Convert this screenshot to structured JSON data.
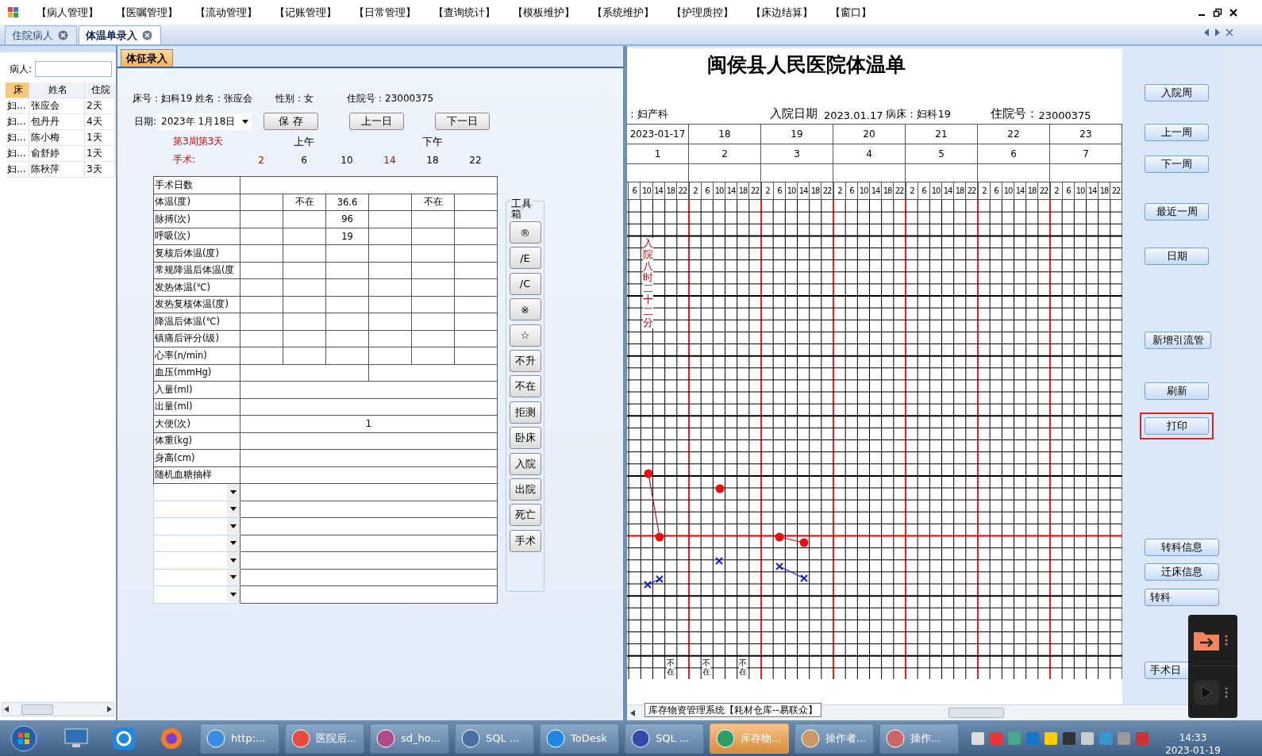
{
  "menu": {
    "items": [
      "【病人管理】",
      "【医嘱管理】",
      "【流动管理】",
      "【记账管理】",
      "【日常管理】",
      "【查询统计】",
      "【模板维护】",
      "【系统维护】",
      "【护理质控】",
      "【床边结算】",
      "【窗口】"
    ]
  },
  "tabs": [
    {
      "label": "住院病人",
      "selected": false
    },
    {
      "label": "体温单录入",
      "selected": true
    }
  ],
  "patient_panel": {
    "search_label": "病人:",
    "columns": [
      "床",
      "姓名",
      "住院"
    ],
    "rows": [
      [
        "妇...",
        "张应会",
        "2天"
      ],
      [
        "妇...",
        "包丹丹",
        "4天"
      ],
      [
        "妇...",
        "陈小梅",
        "1天"
      ],
      [
        "妇...",
        "俞舒婷",
        "1天"
      ],
      [
        "妇...",
        "陈秋萍",
        "3天"
      ]
    ]
  },
  "form": {
    "tab": "体征录入",
    "info": [
      "床号：妇科19 姓名：张应会",
      "性别：女",
      "住院号：23000375"
    ],
    "date_label": "日期:",
    "date_value": "2023年 1月18日",
    "buttons": [
      "保 存",
      "上一日",
      "下一日"
    ],
    "week_day": "第3周第3天",
    "am": "上午",
    "pm": "下午",
    "surgery_label": "手术:",
    "hours": [
      {
        "text": "2",
        "highlight": true
      },
      {
        "text": "6",
        "highlight": false
      },
      {
        "text": "10",
        "highlight": false
      },
      {
        "text": "14",
        "highlight": true
      },
      {
        "text": "18",
        "highlight": false
      },
      {
        "text": "22",
        "highlight": false
      }
    ],
    "rows": [
      {
        "kind": "merged",
        "label": "手术日数"
      },
      {
        "kind": "six",
        "label": "体温(度)",
        "cells": [
          null,
          "不在",
          "36.6",
          null,
          "不在",
          null
        ]
      },
      {
        "kind": "six",
        "label": "脉搏(次)",
        "cells": [
          null,
          null,
          "96",
          null,
          null,
          null
        ]
      },
      {
        "kind": "six",
        "label": "呼吸(次)",
        "cells": [
          null,
          null,
          "19",
          null,
          null,
          null
        ]
      },
      {
        "kind": "six",
        "label": "复核后体温(度)"
      },
      {
        "kind": "six",
        "label": "常规降温后体温(度"
      },
      {
        "kind": "six",
        "label": "发热体温(℃)"
      },
      {
        "kind": "six",
        "label": "发热复核体温(度)"
      },
      {
        "kind": "six",
        "label": "降温后体温(℃)"
      },
      {
        "kind": "six",
        "label": "镇痛后评分(级)"
      },
      {
        "kind": "six",
        "label": "心率(n/min)"
      },
      {
        "kind": "two",
        "label": "血压(mmHg)"
      },
      {
        "kind": "merged",
        "label": "入量(ml)"
      },
      {
        "kind": "merged",
        "label": "出量(ml)"
      },
      {
        "kind": "merged",
        "label": "大便(次)",
        "value": "1"
      },
      {
        "kind": "merged",
        "label": "体重(kg)"
      },
      {
        "kind": "merged",
        "label": "身高(cm)"
      },
      {
        "kind": "merged",
        "label": "随机血糖抽样"
      },
      {
        "kind": "dropdown"
      },
      {
        "kind": "dropdown"
      },
      {
        "kind": "dropdown"
      },
      {
        "kind": "dropdown"
      },
      {
        "kind": "dropdown"
      },
      {
        "kind": "dropdown"
      },
      {
        "kind": "dropdown"
      }
    ]
  },
  "toolbox": {
    "title": "工具箱",
    "buttons": [
      "®",
      "/E",
      "/C",
      "※",
      "☆",
      "不升",
      "不在",
      "拒测",
      "卧床",
      "入院",
      "出院",
      "死亡",
      "手术"
    ]
  },
  "chart": {
    "title": "闽侯县人民医院体温单",
    "dept": "：妇产科",
    "admit_label": "入院日期",
    "admit_date": "2023.01.17",
    "bed": "病床：妇科19",
    "inpatient_label": "住院号：",
    "inpatient_no": "23000375",
    "days": [
      {
        "date": "2023-01-17",
        "day": "1",
        "hours": [
          "6",
          "10",
          "14",
          "18",
          "22"
        ]
      },
      {
        "date": "18",
        "day": "2",
        "hours": [
          "2",
          "6",
          "10",
          "14",
          "18",
          "22"
        ]
      },
      {
        "date": "19",
        "day": "3",
        "hours": [
          "2",
          "6",
          "10",
          "14",
          "18",
          "22"
        ]
      },
      {
        "date": "20",
        "day": "4",
        "hours": [
          "2",
          "6",
          "10",
          "14",
          "18",
          "22"
        ]
      },
      {
        "date": "21",
        "day": "5",
        "hours": [
          "2",
          "6",
          "10",
          "14",
          "18",
          "22"
        ]
      },
      {
        "date": "22",
        "day": "6",
        "hours": [
          "2",
          "6",
          "10",
          "14",
          "18",
          "22"
        ]
      },
      {
        "date": "23",
        "day": "7",
        "hours": [
          "2",
          "6",
          "10",
          "14",
          "18",
          "22"
        ]
      }
    ],
    "admission_note": "入院八时二十二分",
    "absent_marks": [
      "不在",
      "不在",
      "不在"
    ]
  },
  "chart_buttons": [
    {
      "label": "入院周",
      "highlighted": false
    },
    {
      "label": "上一周",
      "highlighted": false
    },
    {
      "label": "下一周",
      "highlighted": false
    },
    {
      "label": "最近一周",
      "highlighted": false
    },
    {
      "label": "日期",
      "highlighted": false
    },
    {
      "label": "新增引流管",
      "highlighted": false
    },
    {
      "label": "刷新",
      "highlighted": false
    },
    {
      "label": "打印",
      "highlighted": true
    },
    {
      "label": "转科信息",
      "highlighted": false
    },
    {
      "label": "迁床信息",
      "highlighted": false
    },
    {
      "label": "转科",
      "highlighted": false
    },
    {
      "label": "手术日",
      "highlighted": false
    }
  ],
  "tooltip": "库存物资管理系统【耗材仓库--易联众】",
  "taskbar": {
    "items": [
      {
        "label": "http:...",
        "active": false
      },
      {
        "label": "医院后...",
        "active": false
      },
      {
        "label": "sd_ho...",
        "active": false
      },
      {
        "label": "SQL ...",
        "active": false
      },
      {
        "label": "ToDesk",
        "active": false
      },
      {
        "label": "SQL ...",
        "active": false
      },
      {
        "label": "库存物...",
        "active": true
      },
      {
        "label": "操作者...",
        "active": false
      },
      {
        "label": "操作...",
        "active": false
      }
    ],
    "time": "14:33",
    "date": "2023-01-19"
  }
}
